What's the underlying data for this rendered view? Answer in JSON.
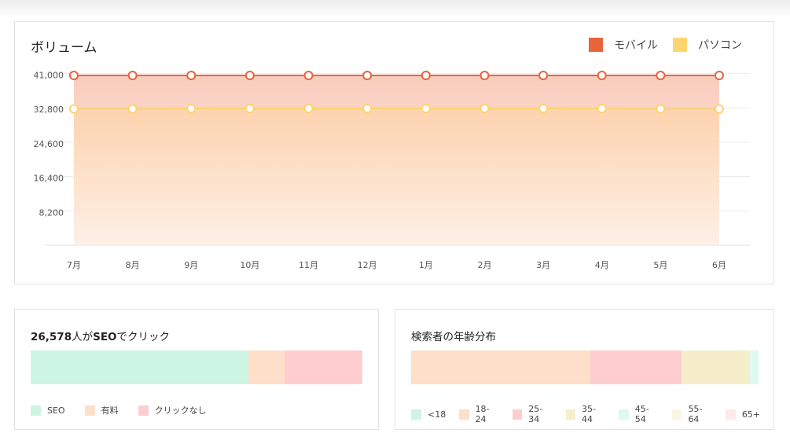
{
  "volume": {
    "title": "ボリューム",
    "legend": [
      {
        "label": "モバイル",
        "color": "#e8643b"
      },
      {
        "label": "パソコン",
        "color": "#fdd46e"
      }
    ]
  },
  "chart_data": {
    "type": "area",
    "title": "ボリューム",
    "categories": [
      "7月",
      "8月",
      "9月",
      "10月",
      "11月",
      "12月",
      "1月",
      "2月",
      "3月",
      "4月",
      "5月",
      "6月"
    ],
    "yticks": [
      "8,200",
      "16,400",
      "24,600",
      "32,800",
      "41,000"
    ],
    "ylim": [
      0,
      42000
    ],
    "grid": true,
    "legend_position": "top-right",
    "series": [
      {
        "name": "モバイル",
        "color": "#e8643b",
        "values": [
          40500,
          40500,
          40500,
          40500,
          40500,
          40500,
          40500,
          40500,
          40500,
          40500,
          40500,
          40500
        ]
      },
      {
        "name": "パソコン",
        "color": "#fdd46e",
        "values": [
          32500,
          32500,
          32600,
          32600,
          32600,
          32600,
          32600,
          32600,
          32600,
          32600,
          32500,
          32500
        ]
      }
    ]
  },
  "seo": {
    "title_number": "26,578",
    "title_suffix_1": "人が",
    "title_bold": "SEO",
    "title_suffix_2": "でクリック",
    "segments": [
      {
        "label": "SEO",
        "share": 0.657,
        "color": "#cdf5e4"
      },
      {
        "label": "有料",
        "share": 0.109,
        "color": "#fddfca"
      },
      {
        "label": "クリックなし",
        "share": 0.234,
        "color": "#fdcdd0"
      }
    ]
  },
  "age": {
    "title": "検索者の年齢分布",
    "segments": [
      {
        "label": "<18",
        "share": 0.0,
        "color": "#cdf5e4"
      },
      {
        "label": "18-24",
        "share": 0.515,
        "color": "#fddfca"
      },
      {
        "label": "25-34",
        "share": 0.264,
        "color": "#fdcdd0"
      },
      {
        "label": "35-44",
        "share": 0.197,
        "color": "#f6eecb"
      },
      {
        "label": "45-54",
        "share": 0.024,
        "color": "#defaf0"
      },
      {
        "label": "55-64",
        "share": 0.0,
        "color": "#fbf6e3"
      },
      {
        "label": "65+",
        "share": 0.0,
        "color": "#fde8ea"
      }
    ]
  }
}
